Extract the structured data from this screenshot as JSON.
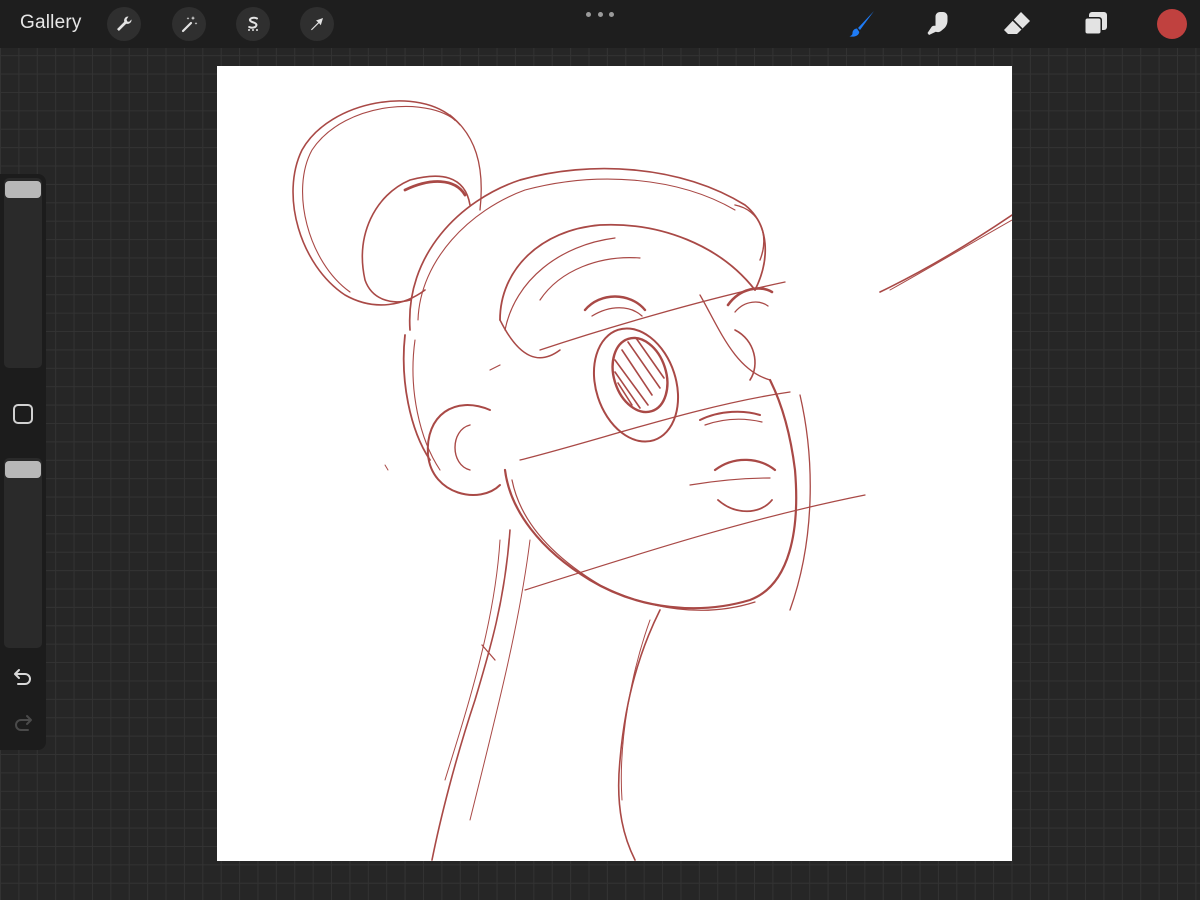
{
  "topbar": {
    "gallery_label": "Gallery",
    "actions": [
      {
        "name": "actions-wrench",
        "icon": "wrench-icon"
      },
      {
        "name": "adjustments",
        "icon": "magic-wand-icon"
      },
      {
        "name": "selection",
        "icon": "selection-s-icon"
      },
      {
        "name": "transform",
        "icon": "arrow-cursor-icon"
      }
    ],
    "more_icon": "ellipsis-icon",
    "tools": [
      {
        "name": "brush",
        "icon": "brush-icon",
        "active": true
      },
      {
        "name": "smudge",
        "icon": "smudge-finger-icon",
        "active": false
      },
      {
        "name": "eraser",
        "icon": "eraser-icon",
        "active": false
      },
      {
        "name": "layers",
        "icon": "layers-icon",
        "active": false
      }
    ],
    "current_color": "#c0413f"
  },
  "colors": {
    "accent": "#1e7bf5",
    "stroke": "#a23a37",
    "icon": "#e3e3e3"
  },
  "sidebar": {
    "brush_size_icon": "slider-handle",
    "modify_icon": "square-modify-icon",
    "opacity_icon": "slider-handle",
    "undo_icon": "undo-arrow-icon",
    "redo_icon": "redo-arrow-icon",
    "redo_enabled": false
  }
}
